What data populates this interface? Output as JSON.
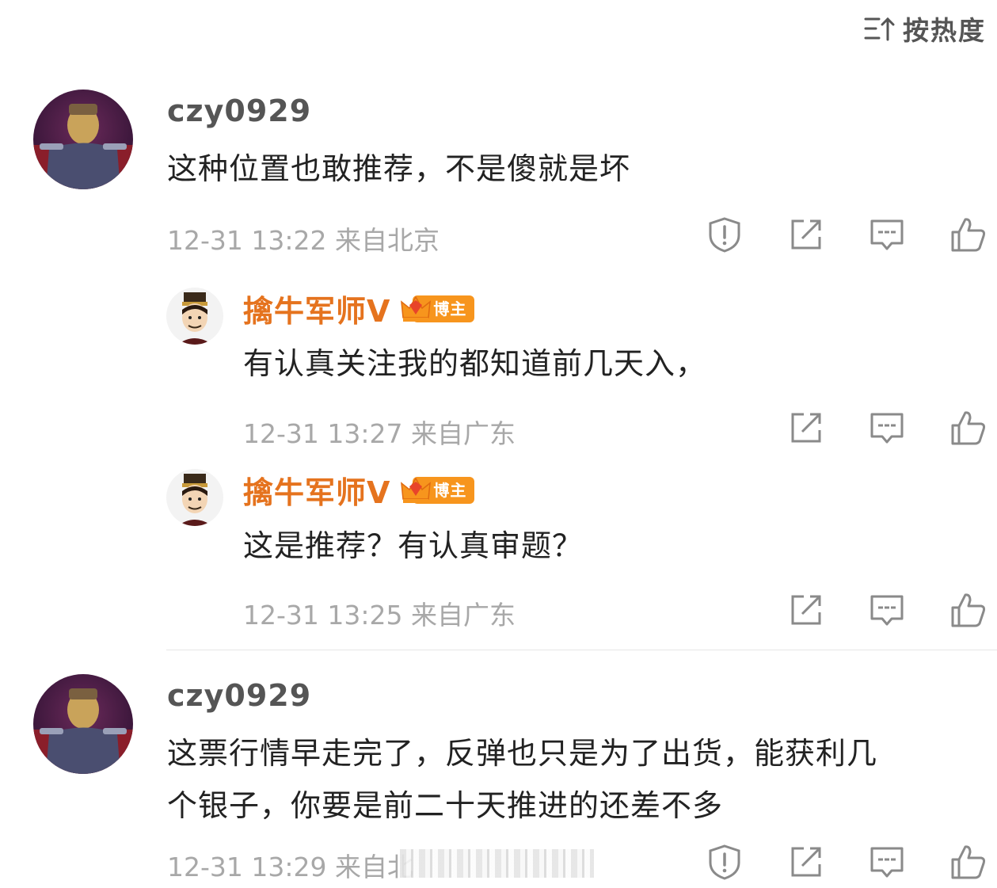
{
  "sort": {
    "label": "按热度",
    "icon": "sort-icon"
  },
  "comments": [
    {
      "username": "czy0929",
      "text": "这种位置也敢推荐，不是傻就是坏",
      "meta": "12-31 13:22  来自北京",
      "replies": [
        {
          "username": "擒牛军师V",
          "badge": "博主",
          "text": "有认真关注我的都知道前几天入，",
          "meta": "12-31 13:27  来自广东"
        },
        {
          "username": "擒牛军师V",
          "badge": "博主",
          "text": "这是推荐？有认真审题？",
          "meta": "12-31 13:25  来自广东"
        }
      ]
    },
    {
      "username": "czy0929",
      "text_line1": "这票行情早走完了，反弹也只是为了出货，能获利几",
      "text_line2": "个银子，你要是前二十天推进的还差不多",
      "meta": "12-31 13:29  来自北"
    }
  ],
  "colors": {
    "accent": "#e5731e",
    "badge": "#f7951d",
    "meta": "#a8a8a8",
    "icon": "#8a8a8a"
  }
}
